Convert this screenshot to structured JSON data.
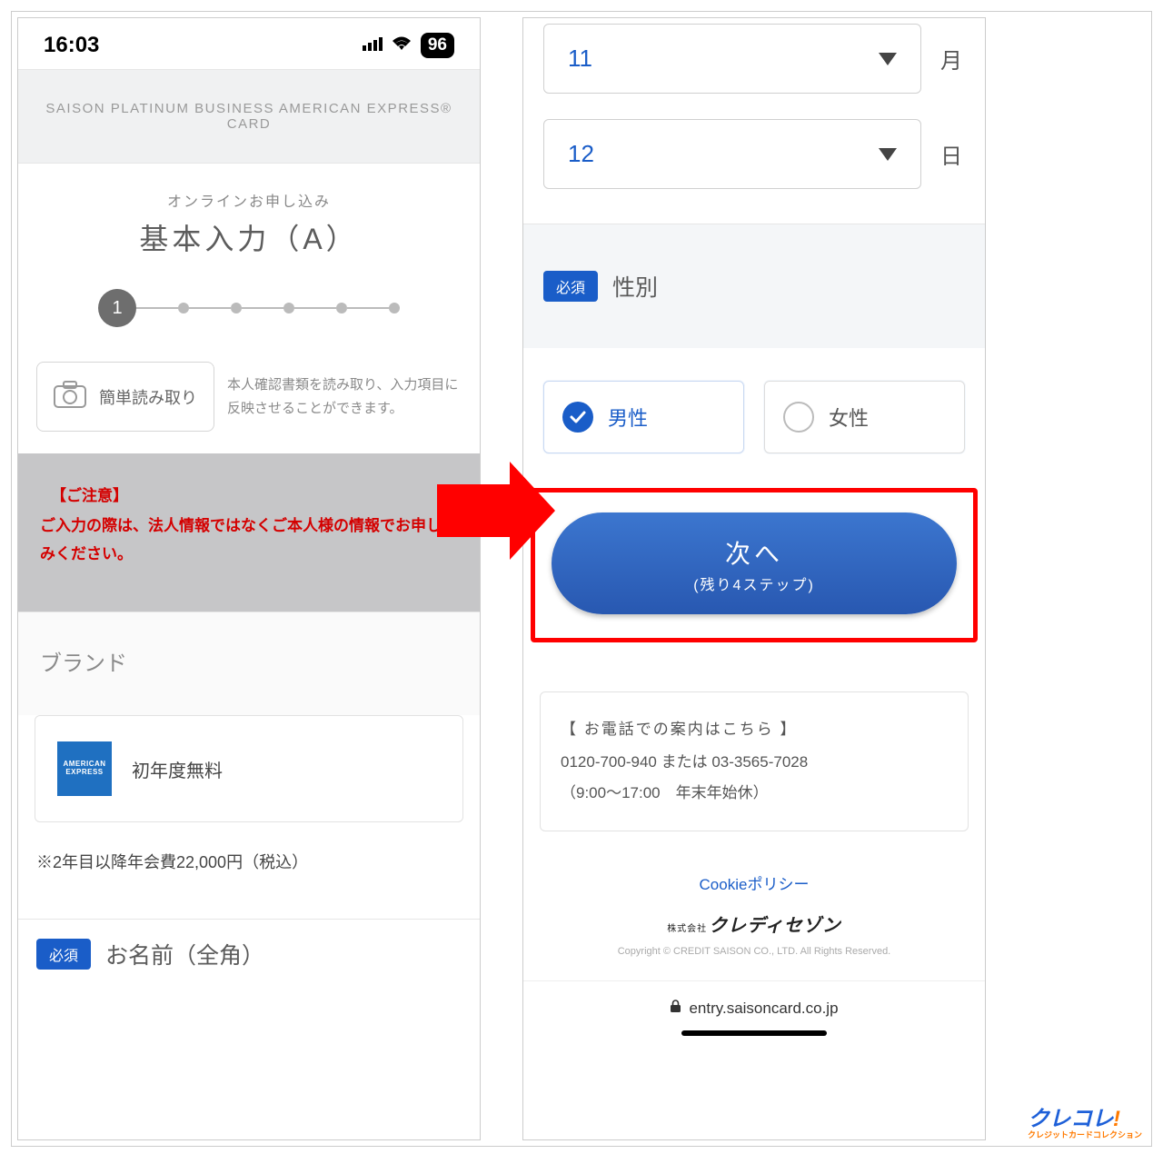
{
  "status": {
    "time": "16:03",
    "battery": "96"
  },
  "cardTitle": "SAISON PLATINUM BUSINESS AMERICAN EXPRESS® CARD",
  "online": {
    "sub": "オンラインお申し込み",
    "main": "基本入力（A）",
    "currentStep": "1"
  },
  "scan": {
    "btn": "簡単読み取り",
    "desc": "本人確認書類を読み取り、入力項目に反映させることができます。"
  },
  "notice": {
    "title": "【ご注意】",
    "body": "ご入力の際は、法人情報ではなくご本人様の情報でお申し込みください。"
  },
  "brand": {
    "header": "ブランド",
    "logoTop": "AMERICAN",
    "logoBottom": "EXPRESS",
    "text": "初年度無料",
    "feeNote": "※2年目以降年会費22,000円（税込）"
  },
  "nameField": {
    "req": "必須",
    "label": "お名前（全角）"
  },
  "month": {
    "value": "11",
    "unit": "月"
  },
  "day": {
    "value": "12",
    "unit": "日"
  },
  "gender": {
    "req": "必須",
    "label": "性別",
    "male": "男性",
    "female": "女性"
  },
  "next": {
    "main": "次へ",
    "sub": "(残り4ステップ)"
  },
  "phoneInfo": {
    "title": "【 お電話での案内はこちら 】",
    "line1": "0120-700-940  または  03-3565-7028",
    "line2": "（9:00〜17:00　年末年始休）"
  },
  "cookie": "Cookieポリシー",
  "companyKanji": "株式会社",
  "companyName": "クレディセゾン",
  "copyright": "Copyright © CREDIT SAISON CO., LTD. All Rights Reserved.",
  "url": "entry.saisoncard.co.jp",
  "watermark": {
    "main": "クレコレ",
    "ex": "!",
    "sub": "クレジットカードコレクション"
  }
}
